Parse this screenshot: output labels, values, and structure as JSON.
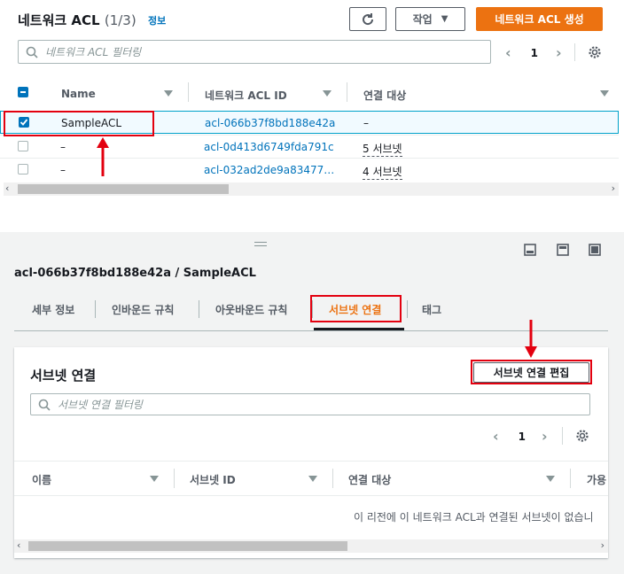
{
  "top": {
    "title": "네트워크 ACL",
    "count": "(1/3)",
    "info": "정보",
    "actions_label": "작업",
    "create_label": "네트워크 ACL 생성",
    "filter_placeholder": "네트워크 ACL 필터링",
    "page": "1",
    "columns": [
      "Name",
      "네트워크 ACL ID",
      "연결 대상"
    ],
    "rows": [
      {
        "name": "SampleACL",
        "id": "acl-066b37f8bd188e42a",
        "assoc": "–",
        "selected": true
      },
      {
        "name": "–",
        "id": "acl-0d413d6749fda791c",
        "assoc": "5 서브넷",
        "selected": false
      },
      {
        "name": "–",
        "id": "acl-032ad2de9a83477…",
        "assoc": "4 서브넷",
        "selected": false
      }
    ]
  },
  "bottom": {
    "heading": "acl-066b37f8bd188e42a / SampleACL",
    "tabs": [
      "세부 정보",
      "인바운드 규칙",
      "아웃바운드 규칙",
      "서브넷 연결",
      "태그"
    ],
    "active_tab": "서브넷 연결",
    "panel_title": "서브넷 연결",
    "edit_label": "서브넷 연결 편집",
    "filter_placeholder": "서브넷 연결 필터링",
    "page": "1",
    "columns": [
      "이름",
      "서브넷 ID",
      "연결 대상",
      "가용"
    ],
    "empty_message": "이 리전에 이 네트워크 ACL과 연결된 서브넷이 없습니"
  },
  "colors": {
    "accent": "#ec7211",
    "link": "#0073bb",
    "annotation": "#e3000f"
  }
}
